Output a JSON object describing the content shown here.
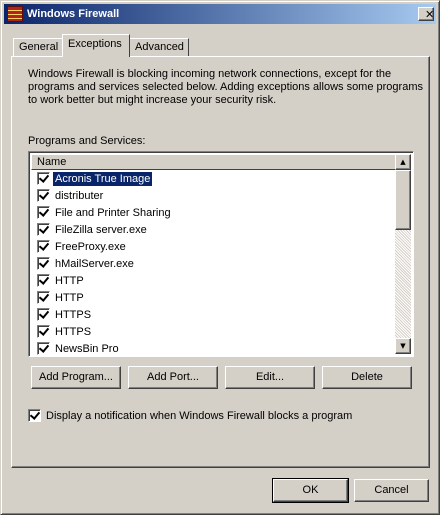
{
  "window": {
    "title": "Windows Firewall",
    "close_glyph": "✕"
  },
  "tabs": [
    {
      "label": "General"
    },
    {
      "label": "Exceptions",
      "active": true
    },
    {
      "label": "Advanced"
    }
  ],
  "exceptions": {
    "description": "Windows Firewall is blocking incoming network connections, except for the programs and services selected below. Adding exceptions allows some programs to work better but might increase your security risk.",
    "list_label": "Programs and Services:",
    "column_header": "Name",
    "items": [
      {
        "label": "Acronis True Image",
        "checked": true,
        "selected": true
      },
      {
        "label": "distributer",
        "checked": true
      },
      {
        "label": "File and Printer Sharing",
        "checked": true
      },
      {
        "label": "FileZilla server.exe",
        "checked": true
      },
      {
        "label": "FreeProxy.exe",
        "checked": true
      },
      {
        "label": "hMailServer.exe",
        "checked": true
      },
      {
        "label": "HTTP",
        "checked": true
      },
      {
        "label": "HTTP",
        "checked": true
      },
      {
        "label": "HTTPS",
        "checked": true
      },
      {
        "label": "HTTPS",
        "checked": true
      },
      {
        "label": "NewsBin Pro",
        "checked": true
      }
    ],
    "scroll_up_glyph": "▲",
    "scroll_down_glyph": "▼",
    "buttons": {
      "add_program": "Add Program...",
      "add_port": "Add Port...",
      "edit": "Edit...",
      "delete": "Delete"
    },
    "notify_label": "Display a notification when Windows Firewall blocks a program",
    "notify_checked": true
  },
  "dialog_buttons": {
    "ok": "OK",
    "cancel": "Cancel"
  },
  "colors": {
    "titlebar_start": "#0a246a",
    "titlebar_end": "#a6caf0",
    "face": "#d4d0c8",
    "selection": "#0a246a"
  },
  "icons": {
    "app": "firewall-brick-icon",
    "close": "close-icon",
    "scroll_up": "arrow-up-icon",
    "scroll_down": "arrow-down-icon",
    "checkbox": "checkbox-checked-icon"
  }
}
